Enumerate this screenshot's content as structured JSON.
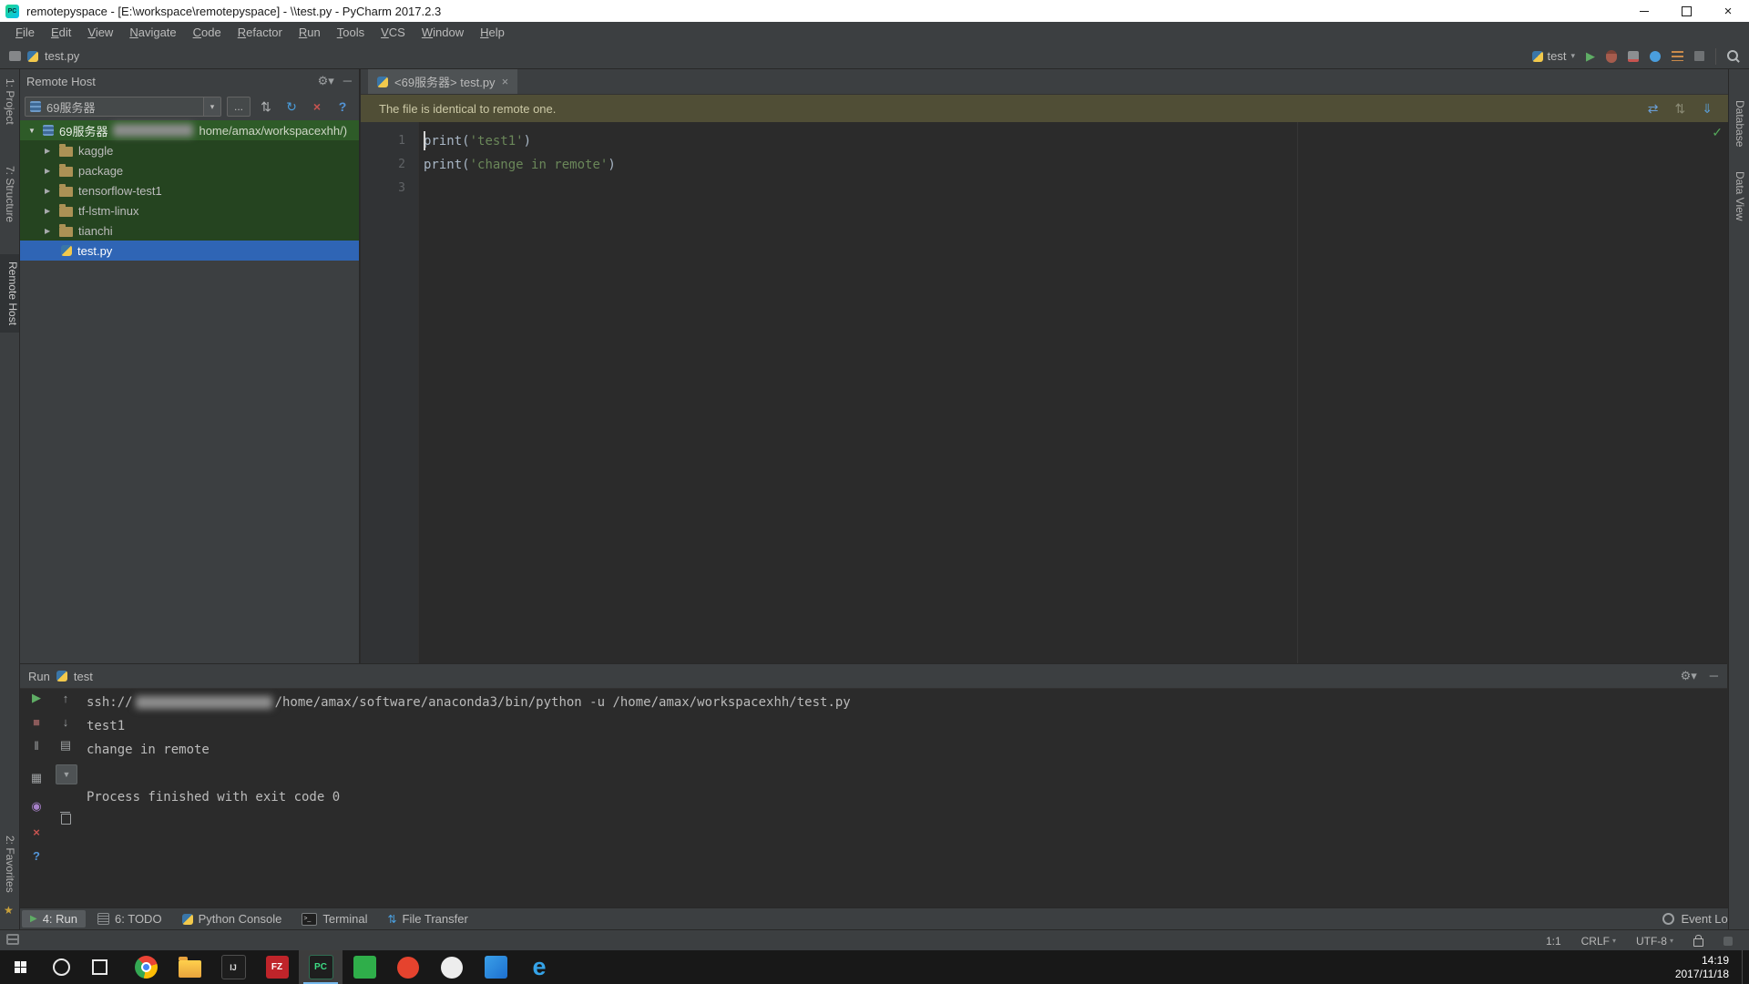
{
  "titlebar": {
    "title": "remotepyspace - [E:\\workspace\\remotepyspace] - \\\\test.py - PyCharm 2017.2.3"
  },
  "menu": {
    "items": [
      "File",
      "Edit",
      "View",
      "Navigate",
      "Code",
      "Refactor",
      "Run",
      "Tools",
      "VCS",
      "Window",
      "Help"
    ]
  },
  "navbar": {
    "file": "test.py"
  },
  "run_widget": {
    "config": "test"
  },
  "strips": {
    "left": [
      "1: Project",
      "7: Structure"
    ],
    "left_active": "Remote Host",
    "left_bottom": "2: Favorites",
    "right": [
      "Database",
      "Data View"
    ]
  },
  "remote_host": {
    "title": "Remote Host",
    "server": "69服务器",
    "tree": {
      "root_name": "69服务器",
      "root_path_visible": "home/amax/workspacexhh/)",
      "folders": [
        "kaggle",
        "package",
        "tensorflow-test1",
        "tf-lstm-linux",
        "tianchi"
      ],
      "file": "test.py"
    }
  },
  "editor": {
    "tab": "<69服务器> test.py",
    "banner": "The file is identical to remote one.",
    "lines": [
      {
        "num": "1",
        "tokens": [
          {
            "t": "print",
            "c": "p"
          },
          {
            "t": "(",
            "c": "p"
          },
          {
            "t": "'test1'",
            "c": "s"
          },
          {
            "t": ")",
            "c": "p"
          }
        ]
      },
      {
        "num": "2",
        "tokens": [
          {
            "t": "print",
            "c": "p"
          },
          {
            "t": "(",
            "c": "p"
          },
          {
            "t": "'change in remote'",
            "c": "s"
          },
          {
            "t": ")",
            "c": "p"
          }
        ]
      },
      {
        "num": "3",
        "tokens": []
      }
    ]
  },
  "run_panel": {
    "label": "Run",
    "config": "test",
    "console": [
      {
        "prefix": "ssh://",
        "redacted": true,
        "suffix": "/home/amax/software/anaconda3/bin/python -u /home/amax/workspacexhh/test.py"
      },
      "test1",
      "change in remote",
      "",
      "Process finished with exit code 0"
    ]
  },
  "bottom_bar": {
    "tools": [
      {
        "label": "4: Run",
        "icon": "run",
        "active": true
      },
      {
        "label": "6: TODO",
        "icon": "todo"
      },
      {
        "label": "Python Console",
        "icon": "python"
      },
      {
        "label": "Terminal",
        "icon": "terminal"
      },
      {
        "label": "File Transfer",
        "icon": "transfer"
      }
    ],
    "event_log": "Event Log"
  },
  "status": {
    "caret": "1:1",
    "line_sep": "CRLF",
    "encoding": "UTF-8"
  },
  "taskbar": {
    "time": "14:19",
    "date": "2017/11/18",
    "apps": [
      {
        "id": "chrome"
      },
      {
        "id": "explorer"
      },
      {
        "id": "intellij",
        "label": "IJ"
      },
      {
        "id": "filezilla",
        "label": "FZ"
      },
      {
        "id": "pycharm",
        "label": "PC",
        "active": true
      },
      {
        "id": "green-tile"
      },
      {
        "id": "red-circle"
      },
      {
        "id": "light-circle"
      },
      {
        "id": "blue-tile"
      },
      {
        "id": "edge",
        "label": "e"
      }
    ]
  },
  "colors": {
    "accent_green": "#499C54",
    "selection_blue": "#2F65B5",
    "deploy_root_green": "#2E5B28",
    "banner_olive": "#504E36"
  }
}
